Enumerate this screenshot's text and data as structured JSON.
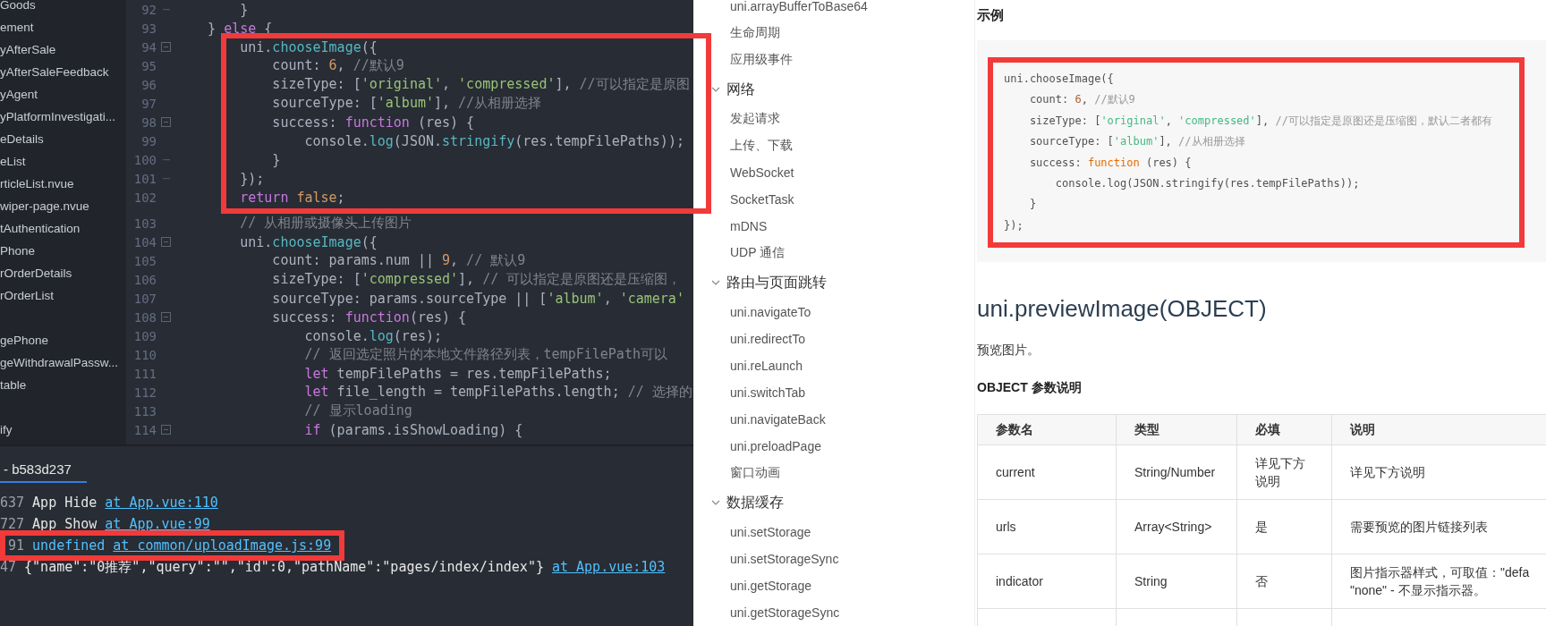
{
  "file_tree": {
    "groups": [
      [
        "Goods",
        "ement",
        "yAfterSale",
        "yAfterSaleFeedback",
        "yAgent",
        "yPlatformInvestigati...",
        "eDetails",
        "eList",
        "rticleList.nvue",
        "wiper-page.nvue",
        "tAuthentication",
        "Phone",
        "rOrderDetails",
        "rOrderList"
      ],
      [
        "gePhone",
        "geWithdrawalPassw...",
        "table"
      ],
      [
        "ify"
      ]
    ]
  },
  "editor": {
    "sections": [
      {
        "highlighted": false,
        "lines": [
          {
            "number": "92",
            "fold_start": false,
            "fold_end": true,
            "tokens": [
              {
                "text": "        }",
                "kind": "plain"
              }
            ]
          },
          {
            "number": "93",
            "fold_start": false,
            "fold_end": false,
            "tokens": [
              {
                "text": "    } ",
                "kind": "plain"
              },
              {
                "text": "else",
                "kind": "keyword"
              },
              {
                "text": " {",
                "kind": "plain"
              }
            ]
          }
        ]
      },
      {
        "highlighted": true,
        "lines": [
          {
            "number": "94",
            "fold_start": true,
            "fold_end": false,
            "tokens": [
              {
                "text": "        uni.",
                "kind": "plain"
              },
              {
                "text": "chooseImage",
                "kind": "func"
              },
              {
                "text": "({",
                "kind": "plain"
              }
            ]
          },
          {
            "number": "95",
            "fold_start": false,
            "fold_end": false,
            "tokens": [
              {
                "text": "            count: ",
                "kind": "plain"
              },
              {
                "text": "6",
                "kind": "number"
              },
              {
                "text": ", ",
                "kind": "plain"
              },
              {
                "text": "//默认9",
                "kind": "comment"
              }
            ]
          },
          {
            "number": "96",
            "fold_start": false,
            "fold_end": false,
            "tokens": [
              {
                "text": "            sizeType: [",
                "kind": "plain"
              },
              {
                "text": "'original'",
                "kind": "string"
              },
              {
                "text": ", ",
                "kind": "plain"
              },
              {
                "text": "'compressed'",
                "kind": "string"
              },
              {
                "text": "], ",
                "kind": "plain"
              },
              {
                "text": "//可以指定是原图",
                "kind": "comment"
              }
            ]
          },
          {
            "number": "97",
            "fold_start": false,
            "fold_end": false,
            "tokens": [
              {
                "text": "            sourceType: [",
                "kind": "plain"
              },
              {
                "text": "'album'",
                "kind": "string"
              },
              {
                "text": "], ",
                "kind": "plain"
              },
              {
                "text": "//从相册选择",
                "kind": "comment"
              }
            ]
          },
          {
            "number": "98",
            "fold_start": true,
            "fold_end": false,
            "tokens": [
              {
                "text": "            success: ",
                "kind": "plain"
              },
              {
                "text": "function",
                "kind": "keyword"
              },
              {
                "text": " (res) {",
                "kind": "plain"
              }
            ]
          },
          {
            "number": "99",
            "fold_start": false,
            "fold_end": false,
            "tokens": [
              {
                "text": "                console.",
                "kind": "plain"
              },
              {
                "text": "log",
                "kind": "func"
              },
              {
                "text": "(JSON.",
                "kind": "plain"
              },
              {
                "text": "stringify",
                "kind": "func"
              },
              {
                "text": "(res.tempFilePaths));",
                "kind": "plain"
              }
            ]
          },
          {
            "number": "100",
            "fold_start": false,
            "fold_end": true,
            "tokens": [
              {
                "text": "            }",
                "kind": "plain"
              }
            ]
          },
          {
            "number": "101",
            "fold_start": false,
            "fold_end": true,
            "tokens": [
              {
                "text": "        });",
                "kind": "plain"
              }
            ]
          },
          {
            "number": "102",
            "fold_start": false,
            "fold_end": false,
            "tokens": [
              {
                "text": "        return",
                "kind": "keyword"
              },
              {
                "text": " false",
                "kind": "number"
              },
              {
                "text": ";",
                "kind": "plain"
              }
            ]
          }
        ]
      },
      {
        "highlighted": false,
        "lines": [
          {
            "number": "103",
            "fold_start": false,
            "fold_end": false,
            "tokens": [
              {
                "text": "        // 从相册或摄像头上传图片",
                "kind": "comment"
              }
            ]
          },
          {
            "number": "104",
            "fold_start": true,
            "fold_end": false,
            "tokens": [
              {
                "text": "        uni.",
                "kind": "plain"
              },
              {
                "text": "chooseImage",
                "kind": "func"
              },
              {
                "text": "({",
                "kind": "plain"
              }
            ]
          },
          {
            "number": "105",
            "fold_start": false,
            "fold_end": false,
            "tokens": [
              {
                "text": "            count: params.num || ",
                "kind": "plain"
              },
              {
                "text": "9",
                "kind": "number"
              },
              {
                "text": ", ",
                "kind": "plain"
              },
              {
                "text": "// 默认9",
                "kind": "comment"
              }
            ]
          },
          {
            "number": "106",
            "fold_start": false,
            "fold_end": false,
            "tokens": [
              {
                "text": "            sizeType: [",
                "kind": "plain"
              },
              {
                "text": "'compressed'",
                "kind": "string"
              },
              {
                "text": "], ",
                "kind": "plain"
              },
              {
                "text": "// 可以指定是原图还是压缩图，",
                "kind": "comment"
              }
            ]
          },
          {
            "number": "107",
            "fold_start": false,
            "fold_end": false,
            "tokens": [
              {
                "text": "            sourceType: params.sourceType || [",
                "kind": "plain"
              },
              {
                "text": "'album'",
                "kind": "string"
              },
              {
                "text": ", ",
                "kind": "plain"
              },
              {
                "text": "'camera'",
                "kind": "string"
              }
            ]
          },
          {
            "number": "108",
            "fold_start": true,
            "fold_end": false,
            "tokens": [
              {
                "text": "            success: ",
                "kind": "plain"
              },
              {
                "text": "function",
                "kind": "keyword"
              },
              {
                "text": "(res) {",
                "kind": "plain"
              }
            ]
          },
          {
            "number": "109",
            "fold_start": false,
            "fold_end": false,
            "tokens": [
              {
                "text": "                console.",
                "kind": "plain"
              },
              {
                "text": "log",
                "kind": "func"
              },
              {
                "text": "(res);",
                "kind": "plain"
              }
            ]
          },
          {
            "number": "110",
            "fold_start": false,
            "fold_end": false,
            "tokens": [
              {
                "text": "                // 返回选定照片的本地文件路径列表，tempFilePath可以",
                "kind": "comment"
              }
            ]
          },
          {
            "number": "111",
            "fold_start": false,
            "fold_end": false,
            "tokens": [
              {
                "text": "                let",
                "kind": "keyword"
              },
              {
                "text": " tempFilePaths = res.tempFilePaths;",
                "kind": "plain"
              }
            ]
          },
          {
            "number": "112",
            "fold_start": false,
            "fold_end": false,
            "tokens": [
              {
                "text": "                let",
                "kind": "keyword"
              },
              {
                "text": " file_length = tempFilePaths.length; ",
                "kind": "plain"
              },
              {
                "text": "// 选择的",
                "kind": "comment"
              }
            ]
          },
          {
            "number": "113",
            "fold_start": false,
            "fold_end": false,
            "tokens": [
              {
                "text": "                // 显示loading",
                "kind": "comment"
              }
            ]
          },
          {
            "number": "114",
            "fold_start": true,
            "fold_end": false,
            "tokens": [
              {
                "text": "                if",
                "kind": "keyword"
              },
              {
                "text": " (params.isShowLoading) {",
                "kind": "plain"
              }
            ]
          }
        ]
      }
    ]
  },
  "console": {
    "tab": {
      "label": "- b583d237",
      "selected": true
    },
    "lines": [
      {
        "prefix": "637",
        "message": {
          "text": "App Hide",
          "kind": "plain"
        },
        "link": "at App.vue:110",
        "highlighted": false
      },
      {
        "prefix": "727",
        "message": {
          "text": "App Show",
          "kind": "plain"
        },
        "link": "at App.vue:99",
        "highlighted": false
      },
      {
        "prefix": "91",
        "message": {
          "text": "undefined",
          "kind": "value"
        },
        "link": "at common/uploadImage.js:99",
        "highlighted": true
      },
      {
        "prefix": "47",
        "message": {
          "text": "{\"name\":\"0推荐\",\"query\":\"\",\"id\":0,\"pathName\":\"pages/index/index\"}",
          "kind": "plain"
        },
        "link": "at App.vue:103",
        "highlighted": false
      }
    ]
  },
  "docs_nav": {
    "items": [
      {
        "kind": "link",
        "label": "uni.arrayBufferToBase64"
      },
      {
        "kind": "link",
        "label": "生命周期"
      },
      {
        "kind": "link",
        "label": "应用级事件"
      },
      {
        "kind": "section",
        "label": "网络",
        "expanded": true,
        "children": [
          {
            "label": "发起请求"
          },
          {
            "label": "上传、下载"
          },
          {
            "label": "WebSocket"
          },
          {
            "label": "SocketTask"
          },
          {
            "label": "mDNS"
          },
          {
            "label": "UDP 通信"
          }
        ]
      },
      {
        "kind": "section",
        "label": "路由与页面跳转",
        "expanded": true,
        "children": [
          {
            "label": "uni.navigateTo"
          },
          {
            "label": "uni.redirectTo"
          },
          {
            "label": "uni.reLaunch"
          },
          {
            "label": "uni.switchTab"
          },
          {
            "label": "uni.navigateBack"
          },
          {
            "label": "uni.preloadPage"
          },
          {
            "label": "窗口动画"
          }
        ]
      },
      {
        "kind": "section",
        "label": "数据缓存",
        "expanded": true,
        "children": [
          {
            "label": "uni.setStorage"
          },
          {
            "label": "uni.setStorageSync"
          },
          {
            "label": "uni.getStorage"
          },
          {
            "label": "uni.getStorageSync"
          }
        ]
      }
    ]
  },
  "doc": {
    "example_heading": "示例",
    "example_code": {
      "highlighted": true,
      "lines": [
        [
          {
            "text": "uni.chooseImage({",
            "kind": "plain"
          }
        ],
        [
          {
            "text": "    count: ",
            "kind": "plain"
          },
          {
            "text": "6",
            "kind": "number"
          },
          {
            "text": ", ",
            "kind": "plain"
          },
          {
            "text": "//默认9",
            "kind": "comment"
          }
        ],
        [
          {
            "text": "    sizeType: [",
            "kind": "plain"
          },
          {
            "text": "'original'",
            "kind": "string"
          },
          {
            "text": ", ",
            "kind": "plain"
          },
          {
            "text": "'compressed'",
            "kind": "string"
          },
          {
            "text": "], ",
            "kind": "plain"
          },
          {
            "text": "//可以指定是原图还是压缩图，默认二者都有",
            "kind": "comment"
          }
        ],
        [
          {
            "text": "    sourceType: [",
            "kind": "plain"
          },
          {
            "text": "'album'",
            "kind": "string"
          },
          {
            "text": "], ",
            "kind": "plain"
          },
          {
            "text": "//从相册选择",
            "kind": "comment"
          }
        ],
        [
          {
            "text": "    success: ",
            "kind": "plain"
          },
          {
            "text": "function",
            "kind": "keyword"
          },
          {
            "text": " (res) {",
            "kind": "plain"
          }
        ],
        [
          {
            "text": "        console.log(JSON.stringify(res.tempFilePaths));",
            "kind": "plain"
          }
        ],
        [
          {
            "text": "    }",
            "kind": "plain"
          }
        ],
        [
          {
            "text": "});",
            "kind": "plain"
          }
        ]
      ]
    },
    "title": "uni.previewImage(OBJECT)",
    "description": "预览图片。",
    "params_heading": "OBJECT 参数说明",
    "table": {
      "columns": [
        "参数名",
        "类型",
        "必填",
        "说明"
      ],
      "rows": [
        [
          "current",
          "String/Number",
          "详见下方说明",
          "详见下方说明"
        ],
        [
          "urls",
          "Array<String>",
          "是",
          "需要预览的图片链接列表"
        ],
        [
          "indicator",
          "String",
          "否",
          "图片指示器样式，可取值：\"defa\n\"none\" - 不显示指示器。"
        ]
      ]
    }
  }
}
